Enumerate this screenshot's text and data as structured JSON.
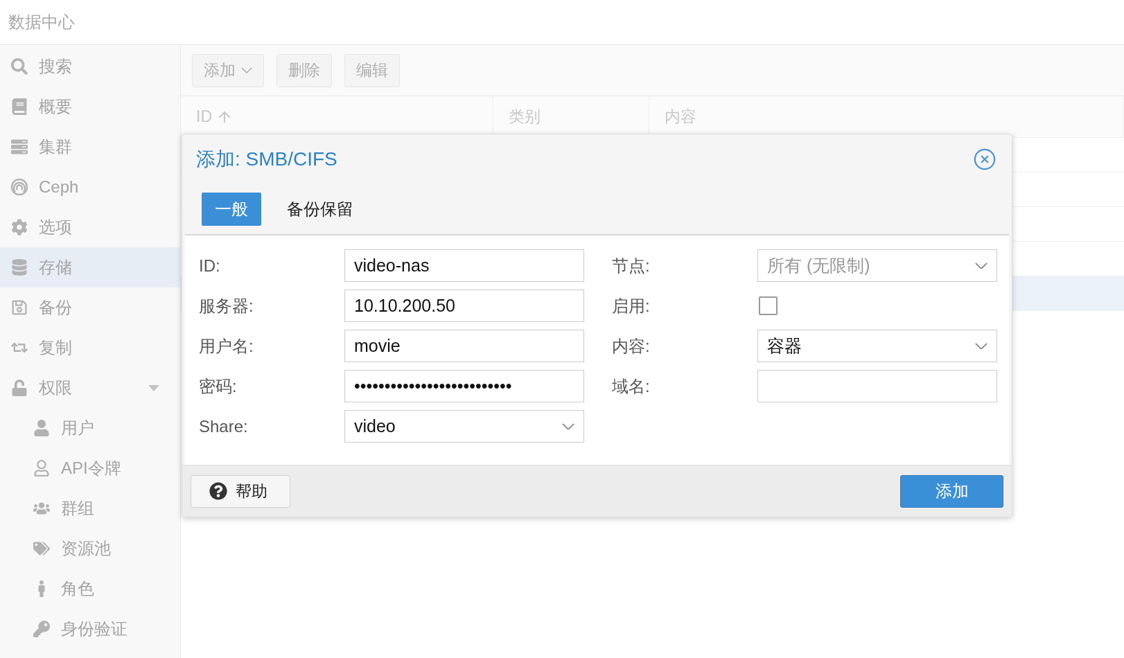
{
  "header": {
    "title": "数据中心"
  },
  "sidebar": {
    "items": [
      {
        "label": "搜索",
        "selected": false
      },
      {
        "label": "概要",
        "selected": false
      },
      {
        "label": "集群",
        "selected": false
      },
      {
        "label": "Ceph",
        "selected": false
      },
      {
        "label": "选项",
        "selected": false
      },
      {
        "label": "存储",
        "selected": true
      },
      {
        "label": "备份",
        "selected": false
      },
      {
        "label": "复制",
        "selected": false
      },
      {
        "label": "权限",
        "selected": false,
        "expanded": true,
        "children": [
          {
            "label": "用户",
            "selected": false
          },
          {
            "label": "API令牌",
            "selected": false
          },
          {
            "label": "群组",
            "selected": false
          },
          {
            "label": "资源池",
            "selected": false
          },
          {
            "label": "角色",
            "selected": false
          },
          {
            "label": "身份验证",
            "selected": false
          }
        ]
      }
    ]
  },
  "toolbar": {
    "buttons": [
      "添加",
      "删除",
      "编辑"
    ]
  },
  "table": {
    "columns": [
      "ID",
      "类别",
      "内容"
    ],
    "rows": [
      {
        "selected": false
      },
      {
        "selected": false
      },
      {
        "selected": false
      },
      {
        "selected": false
      },
      {
        "selected": true
      }
    ]
  },
  "dialog": {
    "title": "添加: SMB/CIFS",
    "tabs": [
      {
        "label": "一般",
        "selected": true
      },
      {
        "label": "备份保留",
        "selected": false
      }
    ],
    "left_fields": [
      {
        "label": "ID:",
        "kind": "text",
        "value": "video-nas"
      },
      {
        "label": "服务器:",
        "kind": "text",
        "value": "10.10.200.50"
      },
      {
        "label": "用户名:",
        "kind": "text",
        "value": "movie"
      },
      {
        "label": "密码:",
        "kind": "text",
        "value": "••••••••••••••••••••••••••"
      },
      {
        "label": "Share:",
        "kind": "select",
        "value": "video"
      }
    ],
    "right_fields": [
      {
        "label": "节点:",
        "kind": "select",
        "placeholder": "所有 (无限制)"
      },
      {
        "label": "启用:",
        "kind": "checkbox",
        "checked": false
      },
      {
        "label": "内容:",
        "kind": "select",
        "value": "容器"
      },
      {
        "label": "域名:",
        "kind": "text"
      }
    ],
    "help_button": "帮助",
    "submit_button": "添加"
  }
}
